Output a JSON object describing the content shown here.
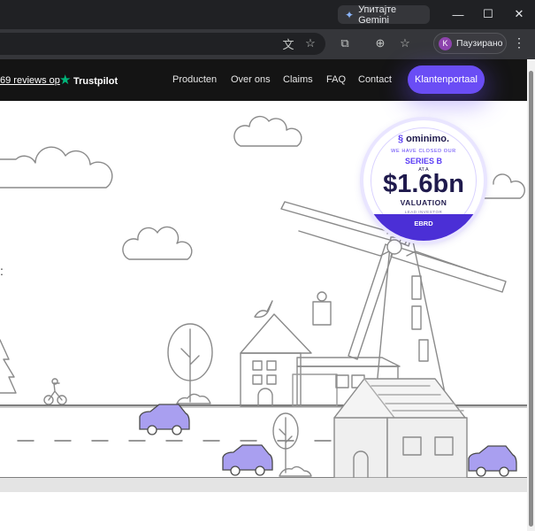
{
  "browser": {
    "gemini_label": "Упитајте Gemini",
    "profile_initial": "K",
    "profile_label": "Паузирано"
  },
  "site": {
    "reviews_text": "69 reviews op",
    "trustpilot": "Trustpilot",
    "nav": [
      "Producten",
      "Over ons",
      "Claims",
      "FAQ",
      "Contact"
    ],
    "portal_button": "Klantenportaal",
    "partial_colon": ":"
  },
  "badge": {
    "brand": "ominimo.",
    "closed": "WE HAVE CLOSED OUR",
    "series": "SERIES B",
    "at_a": "AT A",
    "amount": "$1.6bn",
    "valuation": "VALUATION",
    "lead": "LEAD INVESTOR",
    "investor": "EBRD"
  },
  "icons": {
    "gemini": "gemini-spark-icon",
    "minimize": "minimize-icon",
    "maximize": "maximize-icon",
    "close": "close-icon",
    "translate": "translate-icon",
    "bookmark": "bookmark-star-icon",
    "extensions": "extensions-icon",
    "menu": "menu-dots-icon"
  },
  "colors": {
    "accent": "#6a4df5",
    "nav_bg": "#141414",
    "trustpilot_green": "#00b67a",
    "car": "#a99ff0"
  }
}
